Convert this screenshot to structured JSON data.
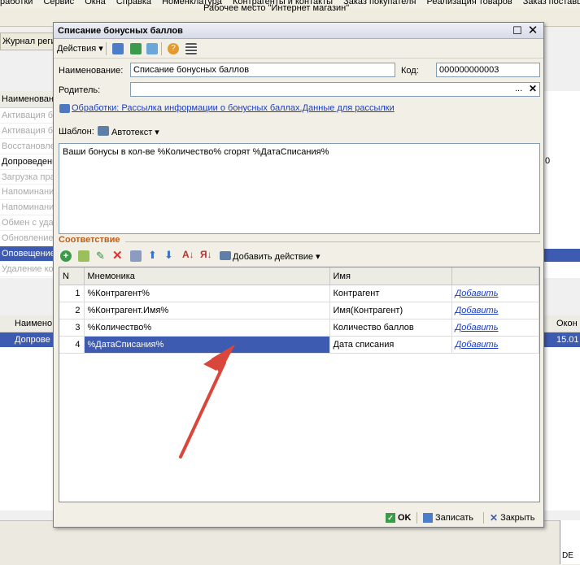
{
  "bg": {
    "menu": [
      "работки",
      "Сервис",
      "Окна",
      "Справка",
      "Номенклатура",
      "Контрагенты и контакты",
      "Заказ покупателя",
      "Реализация товаров",
      "Заказ поставщи"
    ],
    "toolbar_text": "Рабочее место \"Интернет магазин\"",
    "tab_label": "Журнал реги",
    "list_header": "Наименовани",
    "list_rows": [
      "Активация бо",
      "Активация бо",
      "Восстановле",
      "Допроведени",
      "Загрузка пра",
      "Напоминани",
      "Напоминани",
      "Обмен с уда",
      "Обновление",
      "Оповещение",
      "Удаление ко"
    ],
    "list_right_fragment": "0",
    "lower_header": "Наимено",
    "lower_row": "Допрове",
    "right_header": "Окон",
    "right_row": "15.01",
    "status_text": "DE"
  },
  "dialog": {
    "title": "Списание бонусных баллов",
    "actions_label": "Действия",
    "name_label": "Наименование:",
    "name_value": "Списание бонусных баллов",
    "code_label": "Код:",
    "code_value": "000000000003",
    "parent_label": "Родитель:",
    "parent_value": "",
    "parent_select": "...",
    "link_text": "Обработки: Рассылка информации о бонусных баллах.Данные для рассылки",
    "template_label": "Шаблон:",
    "autotext_label": "Автотекст",
    "template_text": "Ваши бонусы в кол-ве %Количество% сгорят %ДатаСписания%",
    "section_title": "Соответствие",
    "add_action_label": "Добавить действие",
    "columns": {
      "n": "N",
      "mnemonic": "Мнемоника",
      "name": "Имя",
      "action": ""
    },
    "rows": [
      {
        "n": "1",
        "mnemonic": "%Контрагент%",
        "name": "Контрагент",
        "action": "Добавить"
      },
      {
        "n": "2",
        "mnemonic": "%Контрагент.Имя%",
        "name": "Имя(Контрагент)",
        "action": "Добавить"
      },
      {
        "n": "3",
        "mnemonic": "%Количество%",
        "name": "Количество баллов",
        "action": "Добавить"
      },
      {
        "n": "4",
        "mnemonic": "%ДатаСписания%",
        "name": "Дата списания",
        "action": "Добавить"
      }
    ],
    "ok_label": "OK",
    "save_label": "Записать",
    "close_label": "Закрыть"
  },
  "colors": {
    "accent": "#3d5bb1",
    "section": "#c25d16",
    "link": "#1a3dc1",
    "arrow": "#d9463c"
  },
  "icons": [
    "maximize-icon",
    "close-icon",
    "save-icon",
    "refresh-icon",
    "copy-icon",
    "help-icon",
    "list-icon",
    "link-icon",
    "autotext-icon",
    "add-icon",
    "copy-row-icon",
    "edit-icon",
    "delete-icon",
    "disk-icon",
    "up-icon",
    "down-icon",
    "sort-asc-icon",
    "sort-desc-icon",
    "add-action-icon",
    "ok-icon",
    "save-icon",
    "close-x-icon"
  ]
}
